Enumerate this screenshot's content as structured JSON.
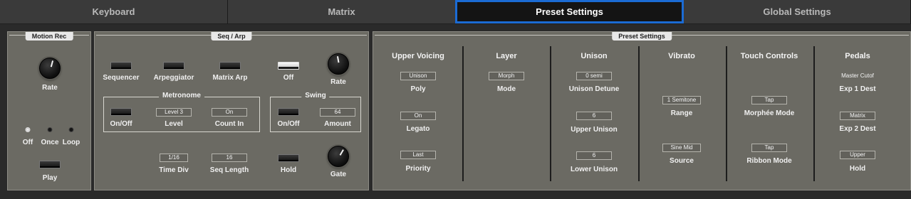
{
  "tabs": [
    {
      "label": "Keyboard",
      "active": false
    },
    {
      "label": "Matrix",
      "active": false
    },
    {
      "label": "Preset Settings",
      "active": true
    },
    {
      "label": "Global Settings",
      "active": false
    }
  ],
  "colors": {
    "accent": "#1b6bd4",
    "panel": "#6b6a63",
    "background": "#2a2a2a"
  },
  "motion_rec": {
    "title": "Motion Rec",
    "rate_label": "Rate",
    "modes": [
      {
        "label": "Off",
        "active": true
      },
      {
        "label": "Once",
        "active": false
      },
      {
        "label": "Loop",
        "active": false
      }
    ],
    "play_label": "Play"
  },
  "seq_arp": {
    "title": "Seq / Arp",
    "sequencer_label": "Sequencer",
    "arpeggiator_label": "Arpeggiator",
    "matrix_arp_label": "Matrix Arp",
    "off_label": "Off",
    "rate_label": "Rate",
    "metronome": {
      "title": "Metronome",
      "onoff_label": "On/Off",
      "level_label": "Level",
      "level_value": "Level 3",
      "count_in_label": "Count In",
      "count_in_value": "On"
    },
    "swing": {
      "title": "Swing",
      "onoff_label": "On/Off",
      "amount_label": "Amount",
      "amount_value": "64"
    },
    "time_div_label": "Time Div",
    "time_div_value": "1/16",
    "seq_length_label": "Seq Length",
    "seq_length_value": "16",
    "hold_label": "Hold",
    "gate_label": "Gate"
  },
  "preset_settings": {
    "title": "Preset Settings",
    "columns": [
      {
        "header": "Upper Voicing",
        "params": [
          {
            "value": "Unison",
            "label": "Poly"
          },
          {
            "value": "On",
            "label": "Legato"
          },
          {
            "value": "Last",
            "label": "Priority"
          }
        ]
      },
      {
        "header": "Layer",
        "params": [
          {
            "value": "Morph",
            "label": "Mode"
          }
        ]
      },
      {
        "header": "Unison",
        "params": [
          {
            "value": "0 semi",
            "label": "Unison Detune"
          },
          {
            "value": "6",
            "label": "Upper Unison"
          },
          {
            "value": "6",
            "label": "Lower Unison"
          }
        ]
      },
      {
        "header": "Vibrato",
        "params": [
          {
            "value": "1 Semitone",
            "label": "Range"
          },
          {
            "value": "Sine Mid",
            "label": "Source"
          }
        ]
      },
      {
        "header": "Touch Controls",
        "params": [
          {
            "value": "Tap",
            "label": "Morphée Mode"
          },
          {
            "value": "Tap",
            "label": "Ribbon Mode"
          }
        ]
      },
      {
        "header": "Pedals",
        "params": [
          {
            "value": "Master Cutof",
            "label": "Exp 1 Dest"
          },
          {
            "value": "Matrix",
            "label": "Exp 2 Dest"
          },
          {
            "value": "Upper",
            "label": "Hold"
          }
        ]
      }
    ]
  }
}
